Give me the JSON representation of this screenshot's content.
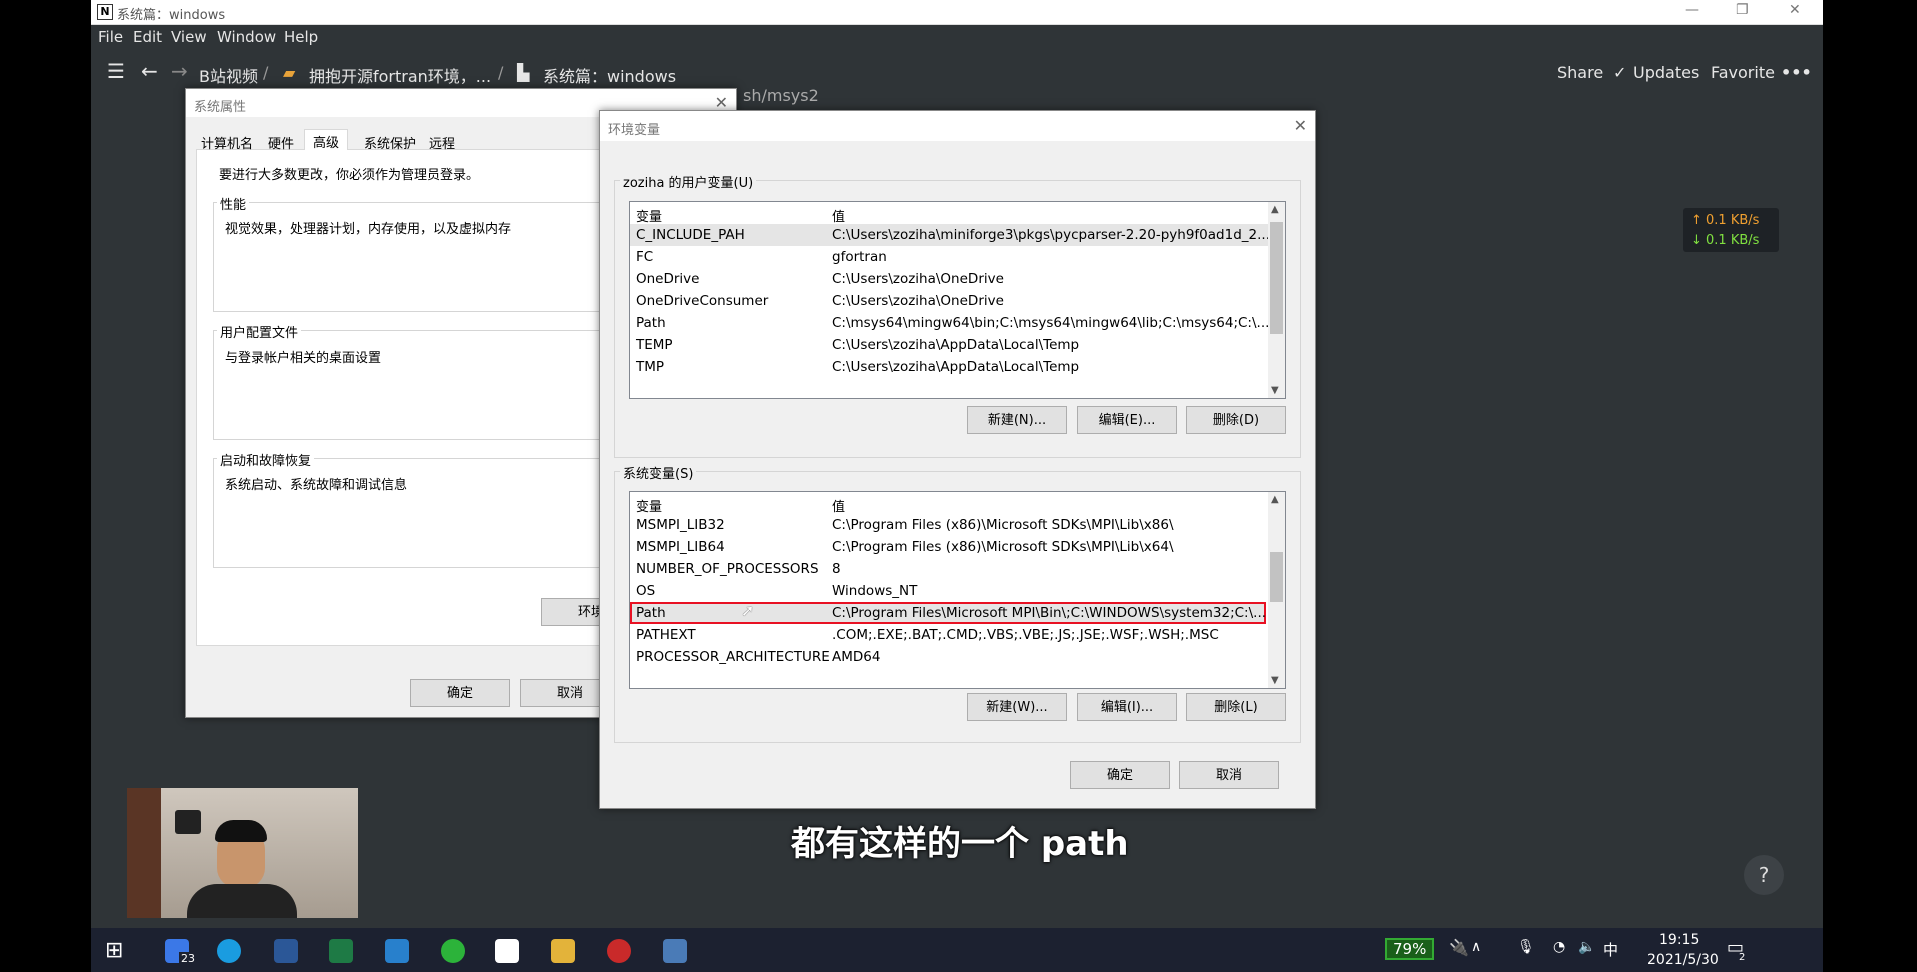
{
  "window": {
    "title": "系统篇：windows",
    "logo": "N"
  },
  "menu": [
    "File",
    "Edit",
    "View",
    "Window",
    "Help"
  ],
  "breadcrumb": [
    "B站视频",
    "拥抱开源fortran环境，...",
    "系统篇：windows"
  ],
  "topbar": {
    "share": "Share",
    "updates": "Updates",
    "favorite": "Favorite",
    "more": "•••"
  },
  "bg_fragment": "sh/msys2",
  "network": {
    "up": "↑ 0.1 KB/s",
    "down": "↓ 0.1 KB/s"
  },
  "sysprops": {
    "title": "系统属性",
    "tabs": [
      "计算机名",
      "硬件",
      "高级",
      "系统保护",
      "远程"
    ],
    "admin_note": "要进行大多数更改，你必须作为管理员登录。",
    "perf": {
      "label": "性能",
      "desc": "视觉效果，处理器计划，内存使用，以及虚拟内存"
    },
    "profile": {
      "label": "用户配置文件",
      "desc": "与登录帐户相关的桌面设置"
    },
    "startup": {
      "label": "启动和故障恢复",
      "desc": "系统启动、系统故障和调试信息"
    },
    "env_button": "环境",
    "ok": "确定",
    "cancel": "取消"
  },
  "envvars": {
    "title": "环境变量",
    "user_label": "zoziha 的用户变量(U)",
    "col_var": "变量",
    "col_val": "值",
    "user_rows": [
      {
        "k": "C_INCLUDE_PAH",
        "v": "C:\\Users\\zoziha\\miniforge3\\pkgs\\pycparser-2.20-pyh9f0ad1d_2..."
      },
      {
        "k": "FC",
        "v": "gfortran"
      },
      {
        "k": "OneDrive",
        "v": "C:\\Users\\zoziha\\OneDrive"
      },
      {
        "k": "OneDriveConsumer",
        "v": "C:\\Users\\zoziha\\OneDrive"
      },
      {
        "k": "Path",
        "v": "C:\\msys64\\mingw64\\bin;C:\\msys64\\mingw64\\lib;C:\\msys64;C:\\..."
      },
      {
        "k": "TEMP",
        "v": "C:\\Users\\zoziha\\AppData\\Local\\Temp"
      },
      {
        "k": "TMP",
        "v": "C:\\Users\\zoziha\\AppData\\Local\\Temp"
      }
    ],
    "user_buttons": [
      "新建(N)...",
      "编辑(E)...",
      "删除(D)"
    ],
    "sys_label": "系统变量(S)",
    "sys_rows": [
      {
        "k": "MSMPI_LIB32",
        "v": "C:\\Program Files (x86)\\Microsoft SDKs\\MPI\\Lib\\x86\\"
      },
      {
        "k": "MSMPI_LIB64",
        "v": "C:\\Program Files (x86)\\Microsoft SDKs\\MPI\\Lib\\x64\\"
      },
      {
        "k": "NUMBER_OF_PROCESSORS",
        "v": "8"
      },
      {
        "k": "OS",
        "v": "Windows_NT"
      },
      {
        "k": "Path",
        "v": "C:\\Program Files\\Microsoft MPI\\Bin\\;C:\\WINDOWS\\system32;C:\\..."
      },
      {
        "k": "PATHEXT",
        "v": ".COM;.EXE;.BAT;.CMD;.VBS;.VBE;.JS;.JSE;.WSF;.WSH;.MSC"
      },
      {
        "k": "PROCESSOR_ARCHITECTURE",
        "v": "AMD64"
      }
    ],
    "sys_buttons": [
      "新建(W)...",
      "编辑(I)...",
      "删除(L)"
    ],
    "ok": "确定",
    "cancel": "取消"
  },
  "subtitle": "都有这样的一个 path",
  "help": "?",
  "taskbar": {
    "badge": "23",
    "battery": "79%",
    "ime": "中",
    "time": "19:15",
    "date": "2021/5/30",
    "notif": "2"
  },
  "colors": {
    "app_bg": "#2f3437",
    "highlight": "#e81123",
    "taskbar": "#1c2130"
  }
}
